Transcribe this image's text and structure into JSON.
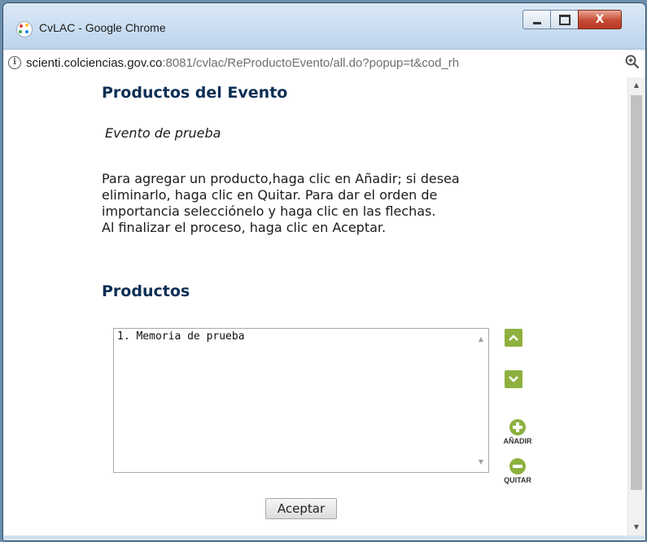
{
  "window": {
    "title": "CvLAC - Google Chrome",
    "close_glyph": "X"
  },
  "addressbar": {
    "url_host": "scienti.colciencias.gov.co",
    "url_rest": ":8081/cvlac/ReProductoEvento/all.do?popup=t&cod_rh",
    "info_icon": "i"
  },
  "page": {
    "title": "Productos del Evento",
    "event_name": "Evento de prueba",
    "instructions": [
      "Para agregar un producto,haga clic en Añadir; si desea",
      "eliminarlo, haga clic en Quitar. Para dar el orden de",
      "importancia selecciónelo y haga clic en las flechas.",
      "Al finalizar el proceso, haga clic en Aceptar."
    ],
    "products_heading": "Productos",
    "products": [
      "1. Memoria de prueba"
    ],
    "add_label": "AÑADIR",
    "remove_label": "QUITAR",
    "accept_label": "Aceptar"
  },
  "colors": {
    "heading": "#0d2f55",
    "action_green": "#8db13f",
    "close_red": "#c74b34"
  }
}
